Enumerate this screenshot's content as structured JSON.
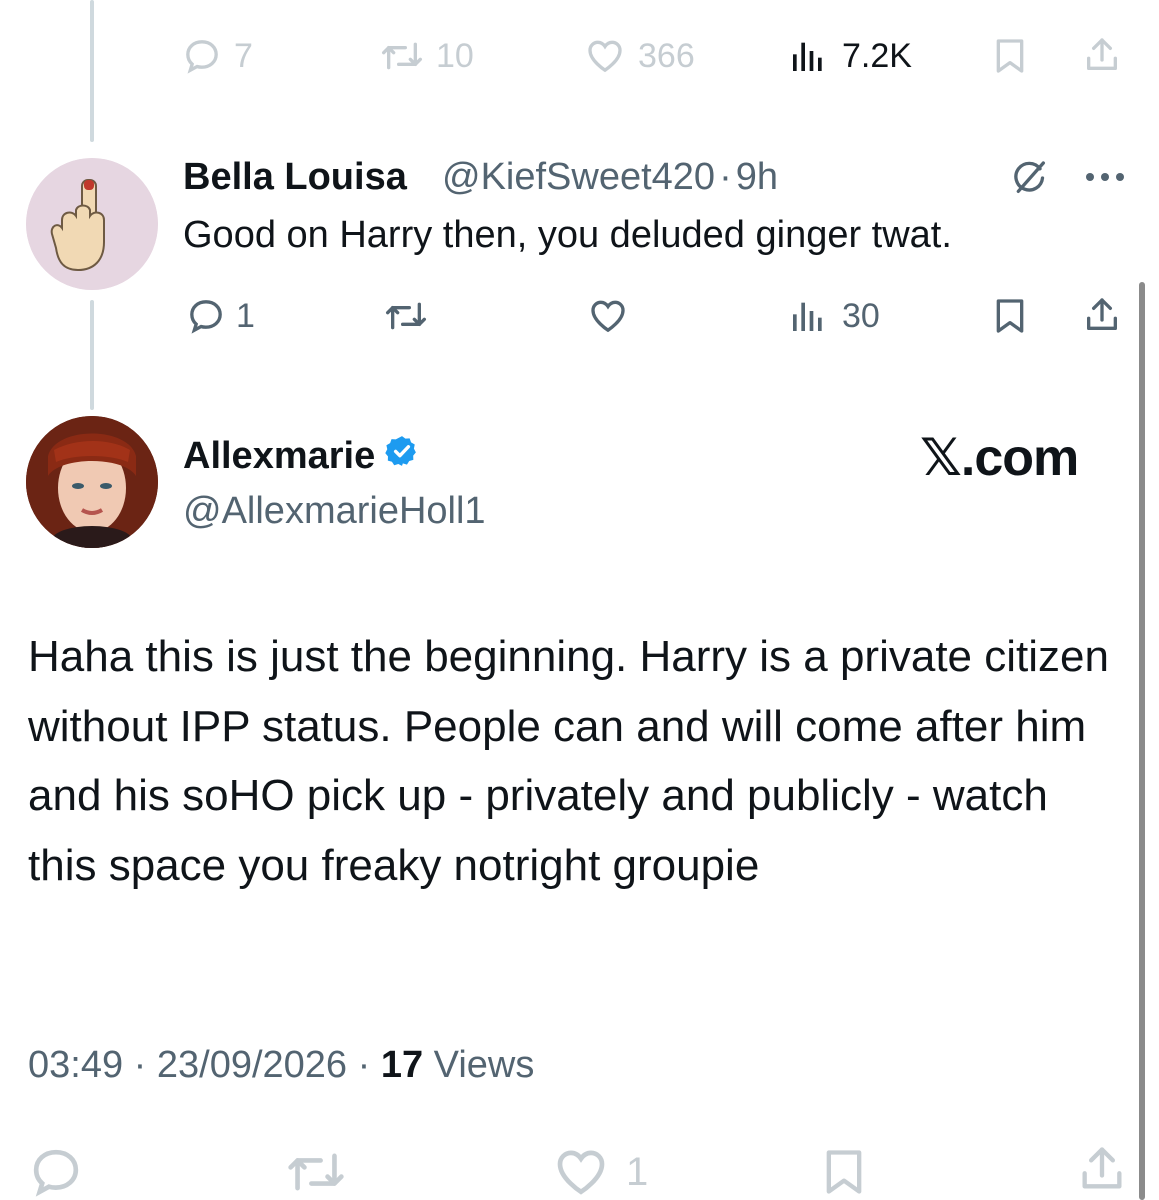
{
  "top_actions": {
    "replies": "7",
    "reposts": "10",
    "likes": "366",
    "views": "7.2K"
  },
  "reply": {
    "name": "Bella Louisa",
    "handle": "@KiefSweet420",
    "separator": "·",
    "time": "9h",
    "text": "Good on Harry then, you deluded ginger twat.",
    "actions": {
      "replies": "1",
      "reposts": "",
      "likes": "",
      "views": "30"
    }
  },
  "main_post": {
    "name": "Allexmarie",
    "handle": "@AllexmarieHoll1",
    "watermark": "𝕏.com",
    "text": "Haha this is just the beginning. Harry is a private citizen without IPP status. People can and will come after him and his soHO pick up - privately and publicly - watch this space you freaky notright groupie",
    "time": "03:49",
    "sep1": " · ",
    "date": "23/09/2026",
    "sep2": " · ",
    "views_count": "17",
    "views_label": " Views",
    "actions": {
      "likes": "1"
    }
  },
  "colors": {
    "text": "#0f1419",
    "secondary": "#536471",
    "faded": "#c6cdd2",
    "verified": "#1d9bf0",
    "thread_line": "#cfd9de"
  }
}
